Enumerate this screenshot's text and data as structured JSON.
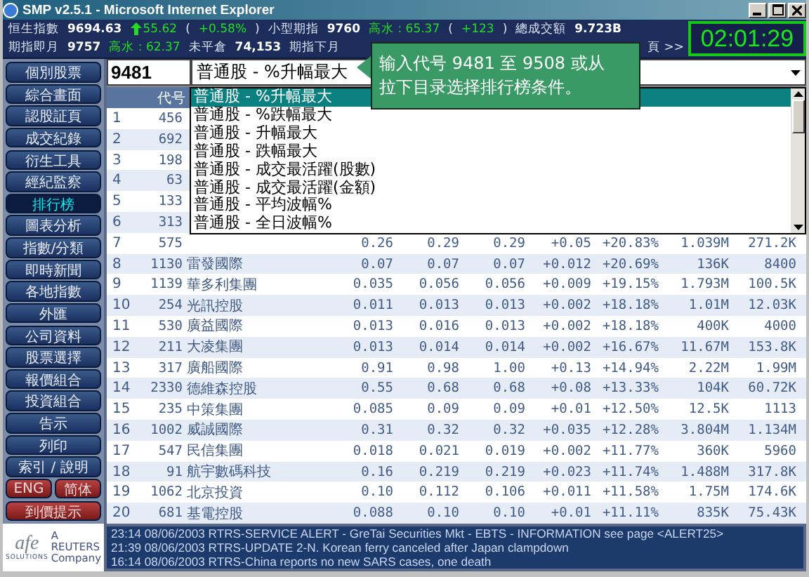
{
  "window": {
    "title": "SMP v2.5.1 - Microsoft Internet Explorer"
  },
  "ticker": {
    "lines": [
      [
        {
          "text": "恒生指數",
          "kind": "label"
        },
        {
          "text": "9694.63",
          "kind": "value"
        },
        {
          "text": "55.62",
          "kind": "up"
        },
        {
          "text": "(",
          "kind": "label"
        },
        {
          "text": "+0.58%",
          "kind": "change"
        },
        {
          "text": ")",
          "kind": "label"
        },
        {
          "text": "小型期指",
          "kind": "label"
        },
        {
          "text": "9760",
          "kind": "value"
        },
        {
          "text": "高水 : 65.37",
          "kind": "change"
        },
        {
          "text": "(",
          "kind": "label"
        },
        {
          "text": "+123",
          "kind": "change"
        },
        {
          "text": ")",
          "kind": "label"
        },
        {
          "text": "總成交額",
          "kind": "label"
        },
        {
          "text": "9.723B",
          "kind": "value"
        }
      ],
      [
        {
          "text": "期指即月",
          "kind": "label"
        },
        {
          "text": "9757",
          "kind": "value"
        },
        {
          "text": "高水 : 62.37",
          "kind": "change"
        },
        {
          "text": "未平倉",
          "kind": "label"
        },
        {
          "text": "74,153",
          "kind": "value"
        },
        {
          "text": "期指下月",
          "kind": "label"
        },
        {
          "text": "頁 >>",
          "kind": "label"
        }
      ]
    ],
    "clock": "02:01:29"
  },
  "tooltip": {
    "lines": [
      "输入代号 9481 至 9508 或从",
      "拉下目录选择排行榜条件。"
    ]
  },
  "sidebar": {
    "items": [
      {
        "label": "個別股票",
        "selected": false
      },
      {
        "label": "綜合畫面",
        "selected": false
      },
      {
        "label": "認股証頁",
        "selected": false
      },
      {
        "label": "成交紀錄",
        "selected": false
      },
      {
        "label": "衍生工具",
        "selected": false
      },
      {
        "label": "經紀監察",
        "selected": false
      },
      {
        "label": "排行榜",
        "selected": true
      },
      {
        "label": "圖表分析",
        "selected": false
      },
      {
        "label": "指數/分類",
        "selected": false
      },
      {
        "label": "即時新聞",
        "selected": false
      },
      {
        "label": "各地指數",
        "selected": false
      },
      {
        "label": "外匯",
        "selected": false
      },
      {
        "label": "公司資料",
        "selected": false
      },
      {
        "label": "股票選擇",
        "selected": false
      },
      {
        "label": "報價組合",
        "selected": false
      },
      {
        "label": "投資組合",
        "selected": false
      },
      {
        "label": "告示",
        "selected": false
      },
      {
        "label": "列印",
        "selected": false
      },
      {
        "label": "索引 / 說明",
        "selected": false
      }
    ],
    "language_buttons": [
      "ENG",
      "简体"
    ],
    "alert_button": "到價提示",
    "logo": {
      "wordmark": "afe",
      "tagline": "SOLUTIONS",
      "company": "A REUTERS Company"
    }
  },
  "query": {
    "code": "9481",
    "condition": "普通股 - %升幅最大",
    "options": [
      {
        "label": "普通股 - %升幅最大",
        "selected": true
      },
      {
        "label": "普通股 - %跌幅最大",
        "selected": false
      },
      {
        "label": "普通股 - 升幅最大",
        "selected": false
      },
      {
        "label": "普通股 - 跌幅最大",
        "selected": false
      },
      {
        "label": "普通股 - 成交最活躍(股數)",
        "selected": false
      },
      {
        "label": "普通股 - 成交最活躍(金額)",
        "selected": false
      },
      {
        "label": "普通股 - 平均波幅%",
        "selected": false
      },
      {
        "label": "普通股 - 全日波幅%",
        "selected": false
      }
    ]
  },
  "table": {
    "columns": [
      "代号"
    ],
    "rows": [
      {
        "rank": "1",
        "code": "456"
      },
      {
        "rank": "2",
        "code": "692"
      },
      {
        "rank": "3",
        "code": "198"
      },
      {
        "rank": "4",
        "code": "63"
      },
      {
        "rank": "5",
        "code": "133"
      },
      {
        "rank": "6",
        "code": "313"
      },
      {
        "rank": "7",
        "code": "575",
        "values": [
          "0.26",
          "0.29",
          "0.29",
          "+0.05",
          "+20.83%",
          "1.039M",
          "271.2K"
        ]
      },
      {
        "rank": "8",
        "code": "1130",
        "name": "雷發國際",
        "values": [
          "0.07",
          "0.07",
          "0.07",
          "+0.012",
          "+20.69%",
          "136K",
          "8400"
        ]
      },
      {
        "rank": "9",
        "code": "1139",
        "name": "華多利集團",
        "values": [
          "0.035",
          "0.056",
          "0.056",
          "+0.009",
          "+19.15%",
          "1.793M",
          "100.5K"
        ]
      },
      {
        "rank": "10",
        "code": "254",
        "name": "光訊控股",
        "values": [
          "0.011",
          "0.013",
          "0.013",
          "+0.002",
          "+18.18%",
          "1.01M",
          "12.03K"
        ]
      },
      {
        "rank": "11",
        "code": "530",
        "name": "廣益國際",
        "values": [
          "0.013",
          "0.016",
          "0.013",
          "+0.002",
          "+18.18%",
          "400K",
          "4000"
        ]
      },
      {
        "rank": "12",
        "code": "211",
        "name": "大凌集團",
        "values": [
          "0.013",
          "0.014",
          "0.014",
          "+0.002",
          "+16.67%",
          "11.67M",
          "153.8K"
        ]
      },
      {
        "rank": "13",
        "code": "317",
        "name": "廣船國際",
        "values": [
          "0.91",
          "0.98",
          "1.00",
          "+0.13",
          "+14.94%",
          "2.22M",
          "1.99M"
        ]
      },
      {
        "rank": "14",
        "code": "2330",
        "name": "德維森控股",
        "values": [
          "0.55",
          "0.68",
          "0.68",
          "+0.08",
          "+13.33%",
          "104K",
          "60.72K"
        ]
      },
      {
        "rank": "15",
        "code": "235",
        "name": "中策集團",
        "values": [
          "0.085",
          "0.09",
          "0.09",
          "+0.01",
          "+12.50%",
          "12.5K",
          "1113"
        ]
      },
      {
        "rank": "16",
        "code": "1002",
        "name": "威誠國際",
        "values": [
          "0.31",
          "0.32",
          "0.32",
          "+0.035",
          "+12.28%",
          "3.804M",
          "1.134M"
        ]
      },
      {
        "rank": "17",
        "code": "547",
        "name": "民信集團",
        "values": [
          "0.018",
          "0.021",
          "0.019",
          "+0.002",
          "+11.77%",
          "360K",
          "5960"
        ]
      },
      {
        "rank": "18",
        "code": "91",
        "name": "航宇數碼科技",
        "values": [
          "0.16",
          "0.219",
          "0.219",
          "+0.023",
          "+11.74%",
          "1.488M",
          "317.8K"
        ]
      },
      {
        "rank": "19",
        "code": "1062",
        "name": "北京投資",
        "values": [
          "0.10",
          "0.112",
          "0.106",
          "+0.011",
          "+11.58%",
          "1.75M",
          "174.6K"
        ]
      },
      {
        "rank": "20",
        "code": "681",
        "name": "基電控股",
        "values": [
          "0.088",
          "0.10",
          "0.10",
          "+0.01",
          "+11.11%",
          "835K",
          "75.43K"
        ]
      }
    ]
  },
  "news": [
    "23:14 08/06/2003 RTRS-SERVICE ALERT - GreTai Securities Mkt - EBTS - INFORMATION see page <ALERT25>",
    "21:39 08/06/2003 RTRS-UPDATE 2-N. Korean ferry canceled after Japan clampdown",
    "16:14 08/06/2003 RTRS-China reports no new SARS cases, one death"
  ]
}
